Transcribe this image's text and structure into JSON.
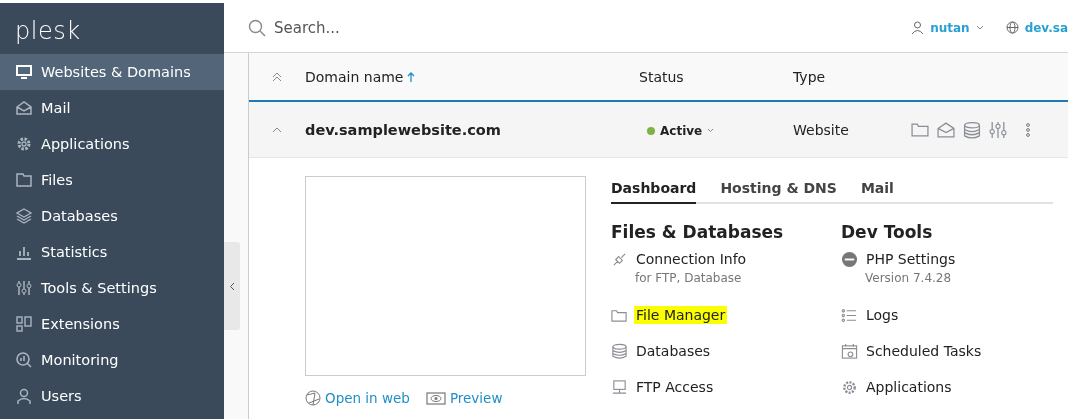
{
  "sidebar": {
    "logo": "plesk",
    "items": [
      {
        "label": "Websites & Domains",
        "selected": true
      },
      {
        "label": "Mail",
        "selected": false
      },
      {
        "label": "Applications",
        "selected": false
      },
      {
        "label": "Files",
        "selected": false
      },
      {
        "label": "Databases",
        "selected": false
      },
      {
        "label": "Statistics",
        "selected": false
      },
      {
        "label": "Tools & Settings",
        "selected": false
      },
      {
        "label": "Extensions",
        "selected": false
      },
      {
        "label": "Monitoring",
        "selected": false
      },
      {
        "label": "Users",
        "selected": false
      }
    ]
  },
  "topbar": {
    "search": {
      "placeholder": "Search..."
    },
    "user": "nutan",
    "subscription": "dev.sa"
  },
  "table": {
    "columns": [
      {
        "label": "Domain name",
        "sorted": true
      },
      {
        "label": "Status",
        "sorted": false
      },
      {
        "label": "Type",
        "sorted": false
      }
    ],
    "rows": [
      {
        "domain": "dev.samplewebsite.com",
        "status": "Active",
        "color": "#7cb342",
        "type": "Website",
        "expanded": true
      }
    ]
  },
  "details": {
    "links": [
      "Open in web",
      "Preview"
    ],
    "tabs": [
      {
        "label": "Dashboard",
        "selected": true
      },
      {
        "label": "Hosting & DNS",
        "selected": false
      },
      {
        "label": "Mail",
        "selected": false
      }
    ],
    "sections": [
      {
        "title": "Files & Databases",
        "items": [
          {
            "label": "Connection Info",
            "note": "for FTP, Database",
            "highlighted": false
          },
          {
            "label": "File Manager",
            "highlighted": true
          },
          {
            "label": "Databases",
            "highlighted": false
          },
          {
            "label": "FTP Access",
            "highlighted": false
          }
        ]
      },
      {
        "title": "Dev Tools",
        "items": [
          {
            "label": "PHP Settings",
            "note": "Version 7.4.28",
            "highlighted": false
          },
          {
            "label": "Logs",
            "highlighted": false
          },
          {
            "label": "Scheduled Tasks",
            "highlighted": false
          },
          {
            "label": "Applications",
            "highlighted": false
          }
        ]
      }
    ]
  }
}
